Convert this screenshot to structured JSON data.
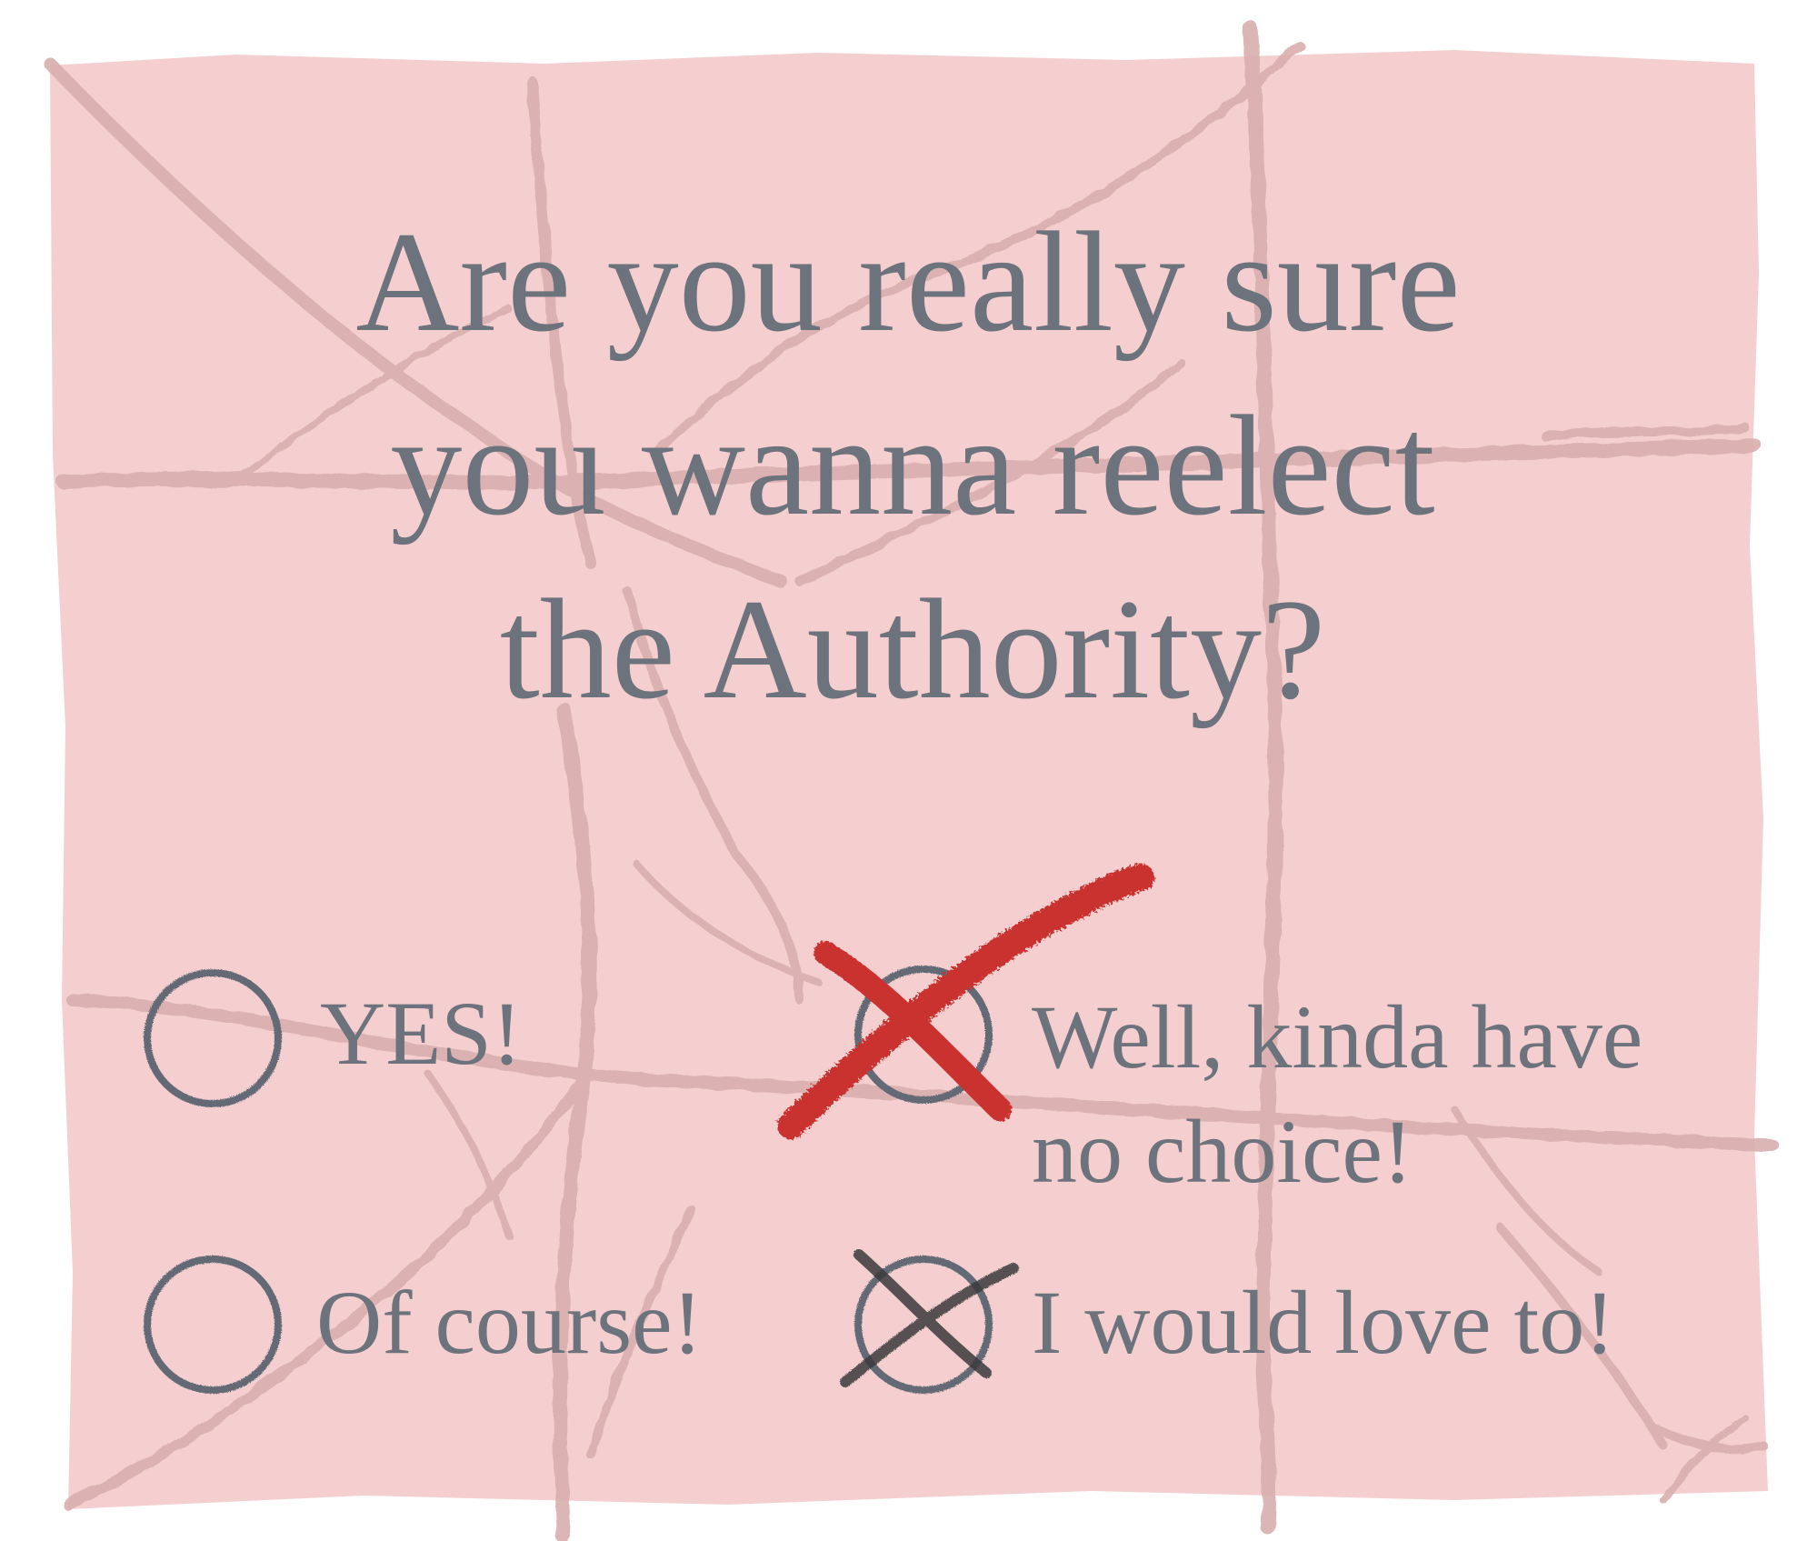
{
  "ballot": {
    "question_lines": [
      "Are you really sure",
      "you wanna reelect",
      "the Authority?"
    ],
    "options": [
      {
        "label_lines": [
          "YES!"
        ],
        "state": "empty"
      },
      {
        "label_lines": [
          "Well, kinda have",
          "no choice!"
        ],
        "state": "red-cross"
      },
      {
        "label_lines": [
          "Of course!"
        ],
        "state": "empty"
      },
      {
        "label_lines": [
          "I would love to!"
        ],
        "state": "black-cross"
      }
    ]
  },
  "colors": {
    "paper": "#f5cfcf",
    "crease": "#d9aeae",
    "text": "#6d737c",
    "circle": "#636a75",
    "red_mark": "#c9302f",
    "black_mark": "#3a3a3d"
  }
}
